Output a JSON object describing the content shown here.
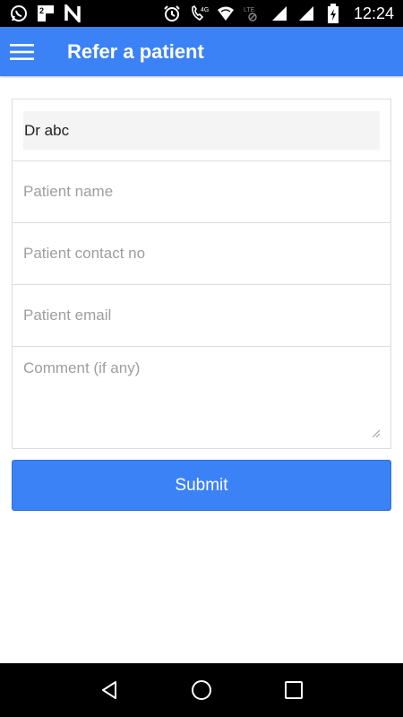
{
  "status_bar": {
    "time": "12:24",
    "icons": [
      "whatsapp-icon",
      "app-notification-icon",
      "n-app-icon",
      "alarm-icon",
      "volte-call-icon",
      "wifi-icon",
      "lte-signal-icon",
      "signal-icon",
      "battery-charging-icon"
    ],
    "network_label": "4G",
    "lte_label": "LTE"
  },
  "app_bar": {
    "title": "Refer a patient",
    "color": "#3b82f6"
  },
  "form": {
    "doctor_value": "Dr abc",
    "patient_name_placeholder": "Patient name",
    "patient_contact_placeholder": "Patient contact no",
    "patient_email_placeholder": "Patient email",
    "comment_placeholder": "Comment (if any)"
  },
  "submit": {
    "label": "Submit",
    "color": "#3b82f6"
  },
  "nav_bar": {
    "icons": [
      "back-icon",
      "home-icon",
      "recents-icon"
    ]
  },
  "notification_badge": "2"
}
